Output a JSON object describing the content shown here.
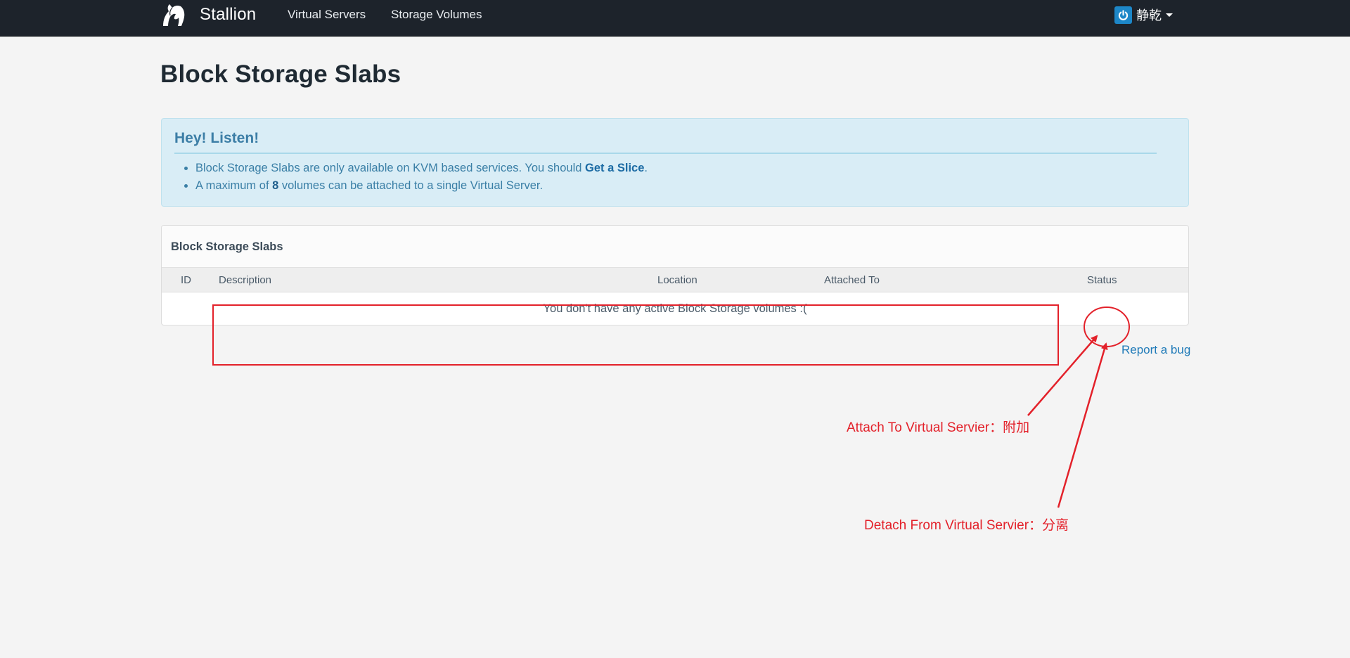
{
  "navbar": {
    "brand": "Stallion",
    "links": [
      "Virtual Servers",
      "Storage Volumes"
    ],
    "user_name": "静乾"
  },
  "page": {
    "title": "Block Storage Slabs"
  },
  "alert": {
    "title": "Hey! Listen!",
    "item1_text": "Block Storage Slabs are only available on KVM based services. You should ",
    "item1_link": "Get a Slice",
    "item1_end": ".",
    "item2_prefix": "A maximum of ",
    "item2_count": "8",
    "item2_suffix": " volumes can be attached to a single Virtual Server."
  },
  "panel": {
    "title": "Block Storage Slabs",
    "columns": [
      "ID",
      "Description",
      "Location",
      "Attached To",
      "Status"
    ],
    "empty_message": "You don't have any active Block Storage volumes :("
  },
  "footer": {
    "report_bug": "Report a bug"
  },
  "annotations": {
    "attach_label": "Attach To Virtual Servier：附加",
    "detach_label": "Detach From Virtual Servier：分离",
    "color": "#e3212a"
  },
  "colors": {
    "navbar_bg": "#1d232b",
    "alert_bg": "#d9edf6",
    "link": "#1f7ab8",
    "power_badge": "#1d87c8"
  }
}
